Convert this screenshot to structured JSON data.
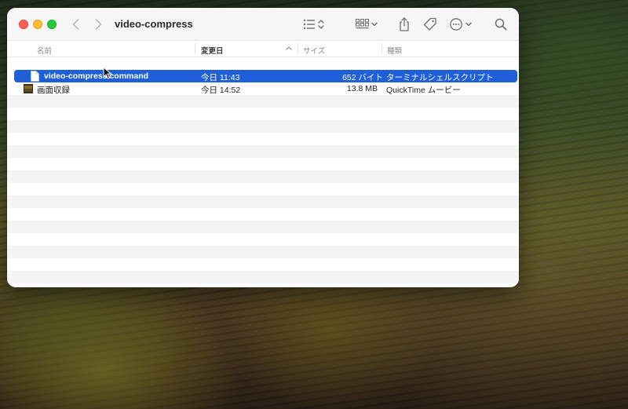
{
  "window": {
    "title": "video-compress"
  },
  "toolbar": {
    "back_icon": "chevron-left-icon",
    "forward_icon": "chevron-right-icon",
    "view_icon": "list-view-icon",
    "group_icon": "grid-group-icon",
    "share_icon": "share-icon",
    "tag_icon": "tag-icon",
    "more_icon": "ellipsis-circle-icon",
    "search_icon": "search-icon"
  },
  "columns": {
    "name": "名前",
    "modified": "変更日",
    "size": "サイズ",
    "kind": "種類"
  },
  "files": [
    {
      "name": "video-compress.command",
      "modified": "今日 11:43",
      "size": "652 バイト",
      "kind": "ターミナルシェルスクリプト",
      "icon": "document-icon",
      "selected": true
    },
    {
      "name": "画面収録",
      "modified": "今日 14:52",
      "size": "13.8 MB",
      "kind": "QuickTime ムービー",
      "icon": "movie-file-icon",
      "selected": false
    }
  ],
  "colors": {
    "selection": "#1f5fd8",
    "close": "#fe5f57",
    "minimize": "#febc2e",
    "zoom": "#28c840"
  }
}
